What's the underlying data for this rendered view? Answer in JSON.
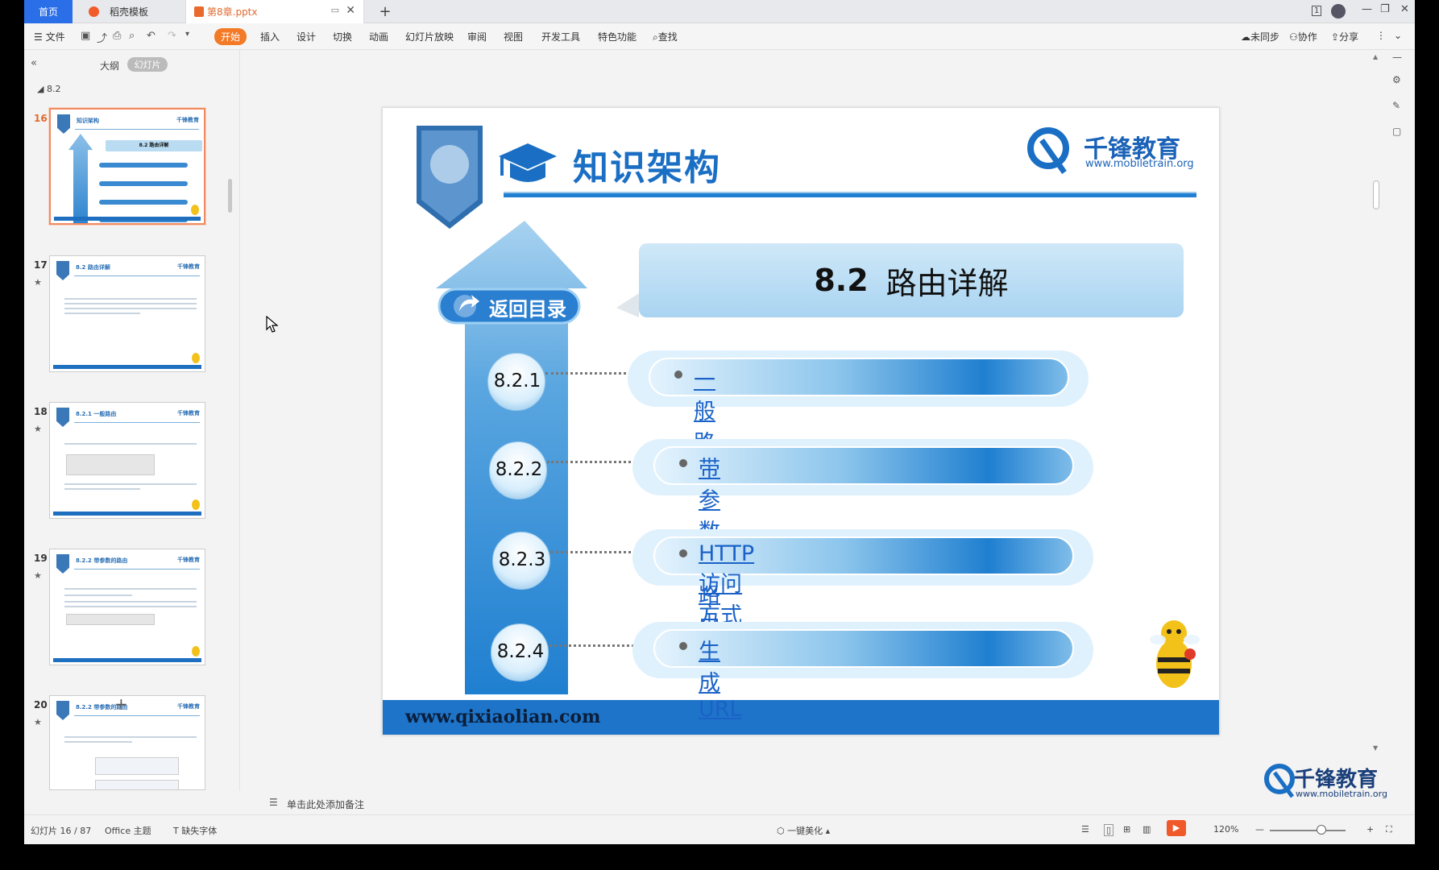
{
  "tabs": {
    "home": "首页",
    "template": "稻壳模板",
    "document": "第8章.pptx"
  },
  "menu": {
    "file": "文件",
    "start": "开始",
    "insert": "插入",
    "design": "设计",
    "transition": "切换",
    "animation": "动画",
    "slideshow": "幻灯片放映",
    "review": "审阅",
    "view": "视图",
    "devtools": "开发工具",
    "features": "特色功能",
    "search": "查找",
    "unsync": "未同步",
    "collaborate": "协作",
    "share": "分享"
  },
  "left_panel": {
    "tab_outline": "大纲",
    "tab_slides": "幻灯片",
    "section": "8.2",
    "thumbnails": [
      {
        "num": "16",
        "title": "知识架构",
        "logo": "千锋教育",
        "subtitle": "8.2  路由详解"
      },
      {
        "num": "17",
        "title": "8.2   路由详解",
        "logo": "千锋教育"
      },
      {
        "num": "18",
        "title": "8.2.1    一般路由",
        "logo": "千锋教育"
      },
      {
        "num": "19",
        "title": "8.2.2    带参数的路由",
        "logo": "千锋教育"
      },
      {
        "num": "20",
        "title": "8.2.2    带参数的路由",
        "logo": "千锋教育"
      }
    ]
  },
  "slide": {
    "title": "知识架构",
    "logo_name": "千锋教育",
    "logo_url": "www.mobiletrain.org",
    "section_title_num": "8.2",
    "section_title_text": "路由详解",
    "back_button": "返回目录",
    "items": [
      {
        "num": "8.2.1",
        "label": "一般路由"
      },
      {
        "num": "8.2.2",
        "label": "带参数的路由"
      },
      {
        "num": "8.2.3",
        "label": "HTTP访问方式"
      },
      {
        "num": "8.2.4",
        "label": "生成URL"
      }
    ],
    "footer_url": "www.qixiaolian.com",
    "colors": {
      "primary": "#1f7fd0",
      "light": "#b7dcf5",
      "link": "#1a62c8"
    }
  },
  "notes_placeholder": "单击此处添加备注",
  "status": {
    "slide_counter": "幻灯片 16 / 87",
    "theme": "Office 主题",
    "missing_font": "缺失字体",
    "beautify": "一键美化",
    "zoom": "120%"
  },
  "watermark": {
    "name": "千锋教育",
    "url": "www.mobiletrain.org"
  }
}
